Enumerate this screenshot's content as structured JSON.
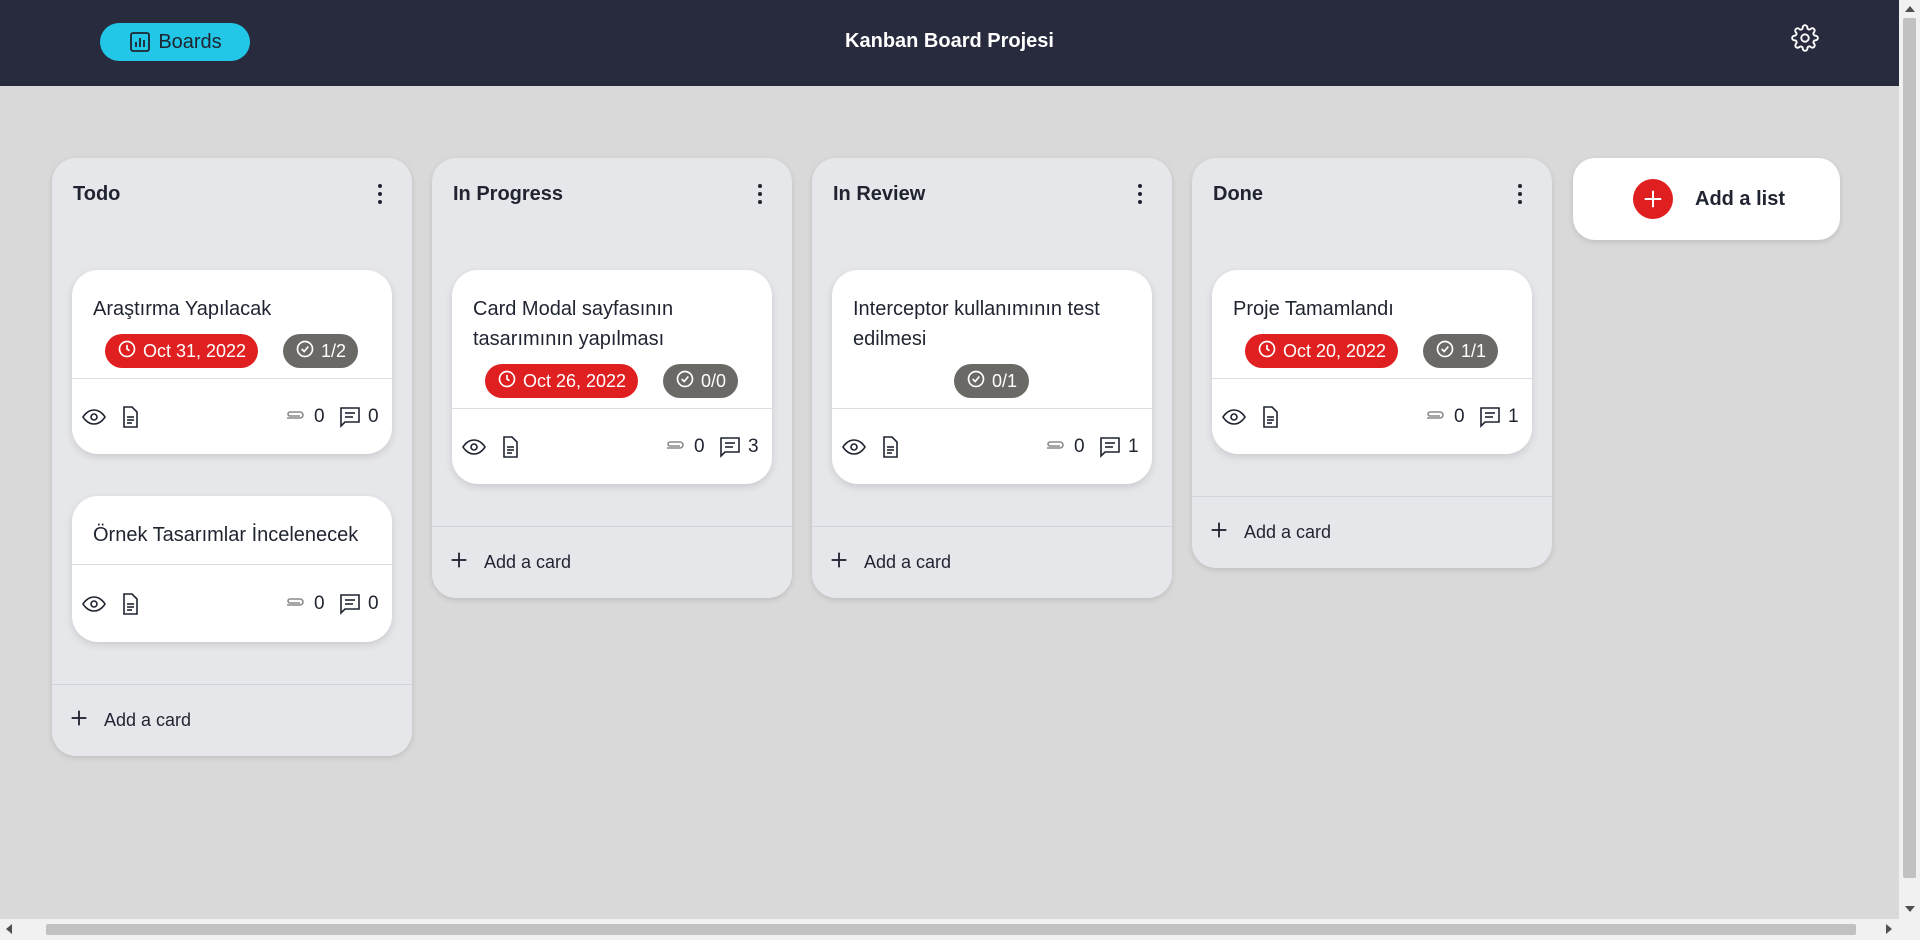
{
  "header": {
    "boards_label": "Boards",
    "title": "Kanban Board Projesi",
    "settings_icon": "gear-icon"
  },
  "colors": {
    "header_bg": "#282b3d",
    "boards_button": "#22c6e6",
    "date_badge": "#e02020",
    "checklist_badge": "#6b6966",
    "add_list_circle": "#e02020"
  },
  "lists": [
    {
      "title": "Todo",
      "add_card_label": "Add a card",
      "cards": [
        {
          "title": "Araştırma Yapılacak",
          "date": "Oct 31, 2022",
          "checklist": "1/2",
          "attachments": "0",
          "comments": "0"
        },
        {
          "title": "Örnek Tasarımlar İncelenecek",
          "attachments": "0",
          "comments": "0"
        }
      ]
    },
    {
      "title": "In Progress",
      "add_card_label": "Add a card",
      "cards": [
        {
          "title": "Card Modal sayfasının tasarımının yapılması",
          "date": "Oct 26, 2022",
          "checklist": "0/0",
          "attachments": "0",
          "comments": "3"
        }
      ]
    },
    {
      "title": "In Review",
      "add_card_label": "Add a card",
      "cards": [
        {
          "title": "Interceptor kullanımının test edilmesi",
          "checklist": "0/1",
          "attachments": "0",
          "comments": "1"
        }
      ]
    },
    {
      "title": "Done",
      "add_card_label": "Add a card",
      "cards": [
        {
          "title": "Proje Tamamlandı",
          "date": "Oct 20, 2022",
          "checklist": "1/1",
          "attachments": "0",
          "comments": "1"
        }
      ]
    }
  ],
  "add_list_label": "Add a list"
}
